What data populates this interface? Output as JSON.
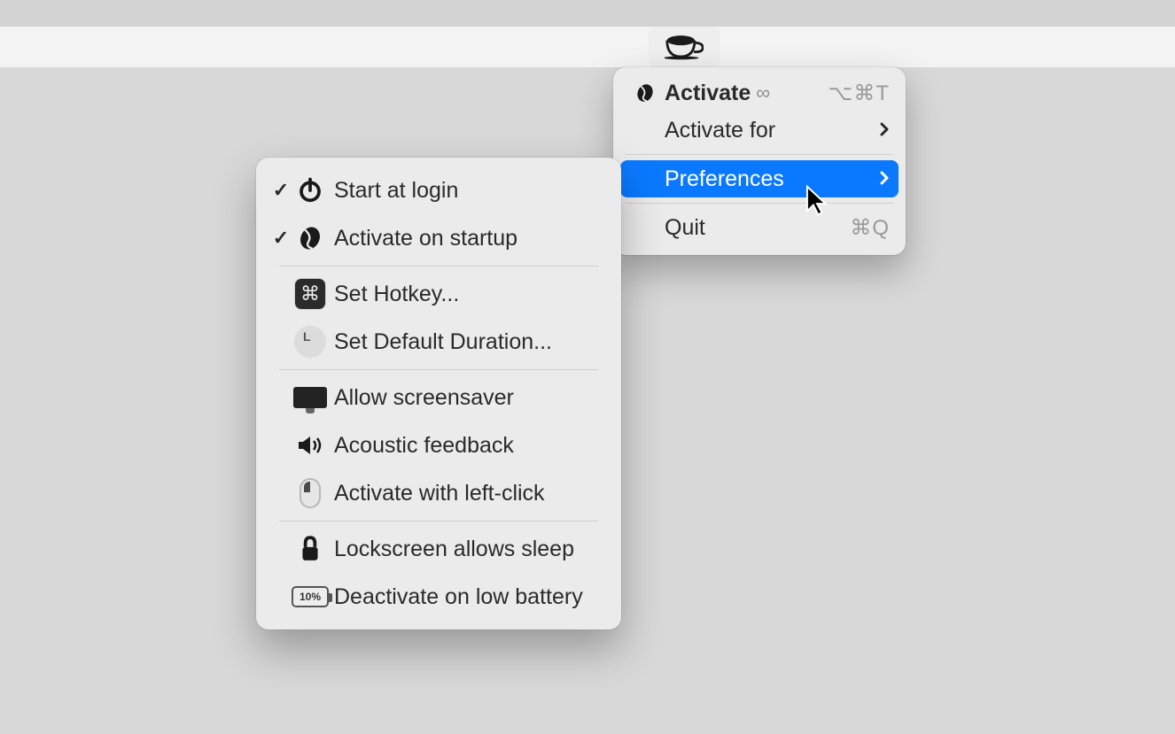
{
  "menubar_icon": "coffee-cup-icon",
  "main_menu": {
    "activate": {
      "label": "Activate",
      "infinity": "∞",
      "shortcut": "⌥⌘T"
    },
    "activate_for": {
      "label": "Activate for"
    },
    "preferences": {
      "label": "Preferences"
    },
    "quit": {
      "label": "Quit",
      "shortcut": "⌘Q"
    }
  },
  "prefs_menu": {
    "start_login": {
      "checked": true,
      "label": "Start at login"
    },
    "activate_startup": {
      "checked": true,
      "label": "Activate on startup"
    },
    "set_hotkey": {
      "checked": false,
      "label": "Set Hotkey..."
    },
    "set_duration": {
      "checked": false,
      "label": "Set Default Duration..."
    },
    "allow_screensaver": {
      "checked": false,
      "label": "Allow screensaver"
    },
    "acoustic": {
      "checked": false,
      "label": "Acoustic feedback"
    },
    "left_click": {
      "checked": false,
      "label": "Activate with left-click"
    },
    "lockscreen": {
      "checked": false,
      "label": "Lockscreen allows sleep"
    },
    "low_battery": {
      "checked": false,
      "label": "Deactivate on low battery",
      "battery_label": "10%"
    }
  }
}
